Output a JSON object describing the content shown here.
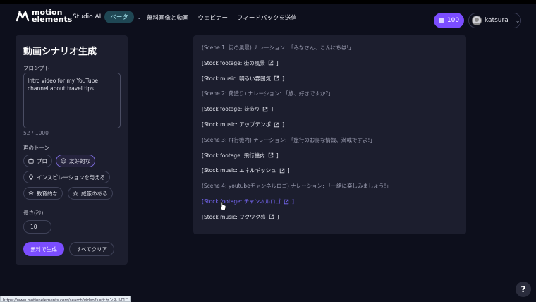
{
  "header": {
    "logo_line1": "motion",
    "logo_line2": "elements",
    "studio_label": "Studio AI",
    "beta_badge": "ベータ",
    "nav_links": [
      "無料画像と動画",
      "ウェビナー",
      "フィードバックを送信"
    ],
    "credits": "100",
    "username": "katsura"
  },
  "left_panel": {
    "title": "動画シナリオ生成",
    "prompt_label": "プロンプト",
    "prompt_value": "Intro video for my YouTube channel about travel tips",
    "char_count": "52 / 1000",
    "tone_label": "声のトーン",
    "tones": [
      {
        "label": "プロ",
        "icon": "briefcase-icon",
        "active": false
      },
      {
        "label": "友好的な",
        "icon": "smile-icon",
        "active": true
      },
      {
        "label": "インスピレーションを与える",
        "icon": "lightbulb-icon",
        "active": false
      },
      {
        "label": "教育的な",
        "icon": "graduation-cap-icon",
        "active": false
      },
      {
        "label": "威厳のある",
        "icon": "star-icon",
        "active": false
      }
    ],
    "length_label": "長さ(秒)",
    "length_value": "10",
    "generate_button": "無料で生成",
    "clear_button": "すべてクリア"
  },
  "scenario": {
    "lines": [
      {
        "type": "scene",
        "text": "(Scene 1: 街の風景) ナレーション: 「みなさん、こんにちは!」"
      },
      {
        "type": "link",
        "prefix": "[",
        "text": "Stock footage: 街の風景",
        "suffix": "]"
      },
      {
        "type": "link",
        "prefix": "[",
        "text": "Stock music: 明るい雰囲気",
        "suffix": "]"
      },
      {
        "type": "scene",
        "text": "(Scene 2: 荷造り) ナレーション: 「旅、好きですか?」"
      },
      {
        "type": "link",
        "prefix": "[",
        "text": "Stock footage: 荷造り",
        "suffix": "]"
      },
      {
        "type": "link",
        "prefix": "[",
        "text": "Stock music: アップテンポ",
        "suffix": "]"
      },
      {
        "type": "scene",
        "text": "(Scene 3: 飛行機内) ナレーション: 「旅行のお得な情報、満載ですよ!」"
      },
      {
        "type": "link",
        "prefix": "[",
        "text": "Stock footage: 飛行機内",
        "suffix": "]"
      },
      {
        "type": "link",
        "prefix": "[",
        "text": "Stock music: エネルギッシュ",
        "suffix": "]"
      },
      {
        "type": "scene",
        "text": "(Scene 4: youtubeチャンネルロゴ) ナレーション: 「一緒に楽しみましょう!」"
      },
      {
        "type": "link-hover",
        "prefix": "[",
        "text": "Stock footage: チャンネルロゴ",
        "suffix": "]"
      },
      {
        "type": "link",
        "prefix": "[",
        "text": "Stock music: ワクワク感",
        "suffix": "]"
      }
    ]
  },
  "status_url": "https://www.motionelements.com/search/video?s=チャンネルロゴ",
  "help_label": "?",
  "colors": {
    "accent": "#7b4dff",
    "panel": "#1c1e2e",
    "background": "#0d0f1c",
    "link_hover": "#7b6bff"
  }
}
